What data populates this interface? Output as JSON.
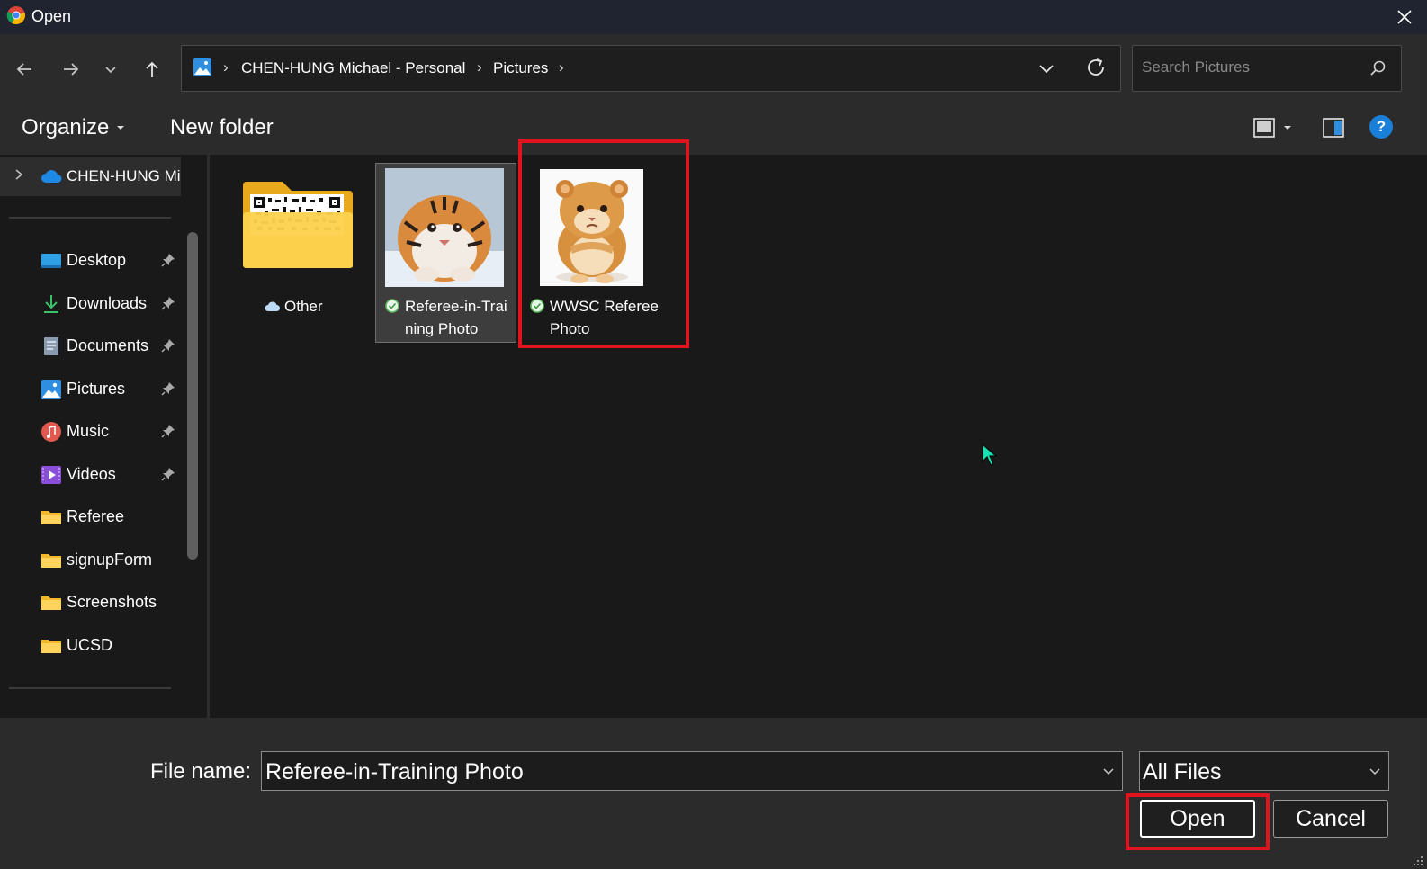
{
  "window": {
    "title": "Open",
    "app_icon": "chrome-logo",
    "close_icon": "close-icon"
  },
  "nav": {
    "back_icon": "arrow-left-icon",
    "forward_icon": "arrow-right-icon",
    "recent_icon": "chevron-down-icon",
    "up_icon": "arrow-up-icon"
  },
  "address": {
    "location_icon": "pictures-icon",
    "breadcrumbs": [
      "CHEN-HUNG Michael - Personal",
      "Pictures"
    ],
    "separator": "›"
  },
  "search": {
    "placeholder": "Search Pictures",
    "value": ""
  },
  "toolbar": {
    "organize_label": "Organize",
    "new_folder_label": "New folder",
    "help_label": "?"
  },
  "sidebar": {
    "root_label": "CHEN-HUNG Michael - Personal",
    "quick_access": [
      {
        "label": "Desktop",
        "icon": "desktop-icon",
        "pinned": true
      },
      {
        "label": "Downloads",
        "icon": "download-icon",
        "pinned": true
      },
      {
        "label": "Documents",
        "icon": "documents-icon",
        "pinned": true
      },
      {
        "label": "Pictures",
        "icon": "pictures-icon",
        "pinned": true
      },
      {
        "label": "Music",
        "icon": "music-icon",
        "pinned": true
      },
      {
        "label": "Videos",
        "icon": "videos-icon",
        "pinned": true
      },
      {
        "label": "Referee",
        "icon": "folder-icon",
        "pinned": false
      },
      {
        "label": "signupForm",
        "icon": "folder-icon",
        "pinned": false
      },
      {
        "label": "Screenshots",
        "icon": "folder-icon",
        "pinned": false
      },
      {
        "label": "UCSD",
        "icon": "folder-icon",
        "pinned": false
      }
    ]
  },
  "files": [
    {
      "label": "Other",
      "kind": "folder",
      "status": "cloud"
    },
    {
      "label_line1": "Referee-in-Trai",
      "label_line2": "ning Photo",
      "kind": "image",
      "status": "synced",
      "selected": true
    },
    {
      "label_line1": "WWSC Referee",
      "label_line2": "Photo",
      "kind": "image",
      "status": "synced",
      "highlighted": true
    }
  ],
  "footer": {
    "file_name_label": "File name:",
    "file_name_value": "Referee-in-Training Photo",
    "file_type_value": "All Files",
    "open_label": "Open",
    "cancel_label": "Cancel"
  },
  "colors": {
    "highlight": "#e0141e",
    "accent": "#1a7fd9",
    "sync_ok": "#5cb85c"
  }
}
